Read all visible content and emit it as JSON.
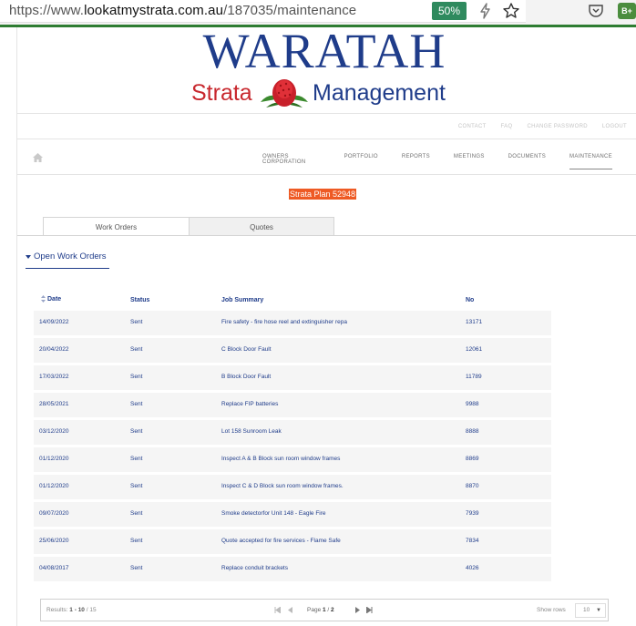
{
  "browser": {
    "url_prefix": "https://www.",
    "url_host": "lookatmystrata.com.au",
    "url_path": "/187035/maintenance",
    "zoom": "50%",
    "extension_badge": "B+"
  },
  "logo": {
    "title": "WARATAH",
    "sub_left": "Strata",
    "sub_right": "Management"
  },
  "util_nav": [
    "CONTACT",
    "FAQ",
    "CHANGE PASSWORD",
    "LOGOUT"
  ],
  "main_nav": [
    "OWNERS CORPORATION",
    "PORTFOLIO",
    "REPORTS",
    "MEETINGS",
    "DOCUMENTS",
    "MAINTENANCE"
  ],
  "plan_label": "Strata Plan 52948",
  "tabs": [
    "Work Orders",
    "Quotes"
  ],
  "section_title": "Open Work Orders",
  "table": {
    "headers": [
      "Date",
      "Status",
      "Job Summary",
      "No"
    ],
    "rows": [
      [
        "14/09/2022",
        "Sent",
        "Fire safety - fire hose reel and extinguisher repa",
        "13171"
      ],
      [
        "20/04/2022",
        "Sent",
        "C Block Door Fault",
        "12061"
      ],
      [
        "17/03/2022",
        "Sent",
        "B Block Door Fault",
        "11789"
      ],
      [
        "28/05/2021",
        "Sent",
        "Replace FIP batteries",
        "9988"
      ],
      [
        "03/12/2020",
        "Sent",
        "Lot 158 Sunroom Leak",
        "8888"
      ],
      [
        "01/12/2020",
        "Sent",
        "Inspect A & B Block sun room window frames",
        "8869"
      ],
      [
        "01/12/2020",
        "Sent",
        "Inspect C & D Block sun room window frames.",
        "8870"
      ],
      [
        "09/07/2020",
        "Sent",
        "Smoke detectorfor Unit 148 - Eagle Fire",
        "7939"
      ],
      [
        "25/06/2020",
        "Sent",
        "Quote accepted for fire services - Flame Safe",
        "7834"
      ],
      [
        "04/08/2017",
        "Sent",
        "Replace conduit brackets",
        "4026"
      ]
    ]
  },
  "pager": {
    "results_label": "Results:",
    "range": "1 - 10",
    "total": "15",
    "page_label": "Page",
    "current_page": "1",
    "total_pages": "2",
    "show_rows_label": "Show rows",
    "rows_value": "10"
  }
}
